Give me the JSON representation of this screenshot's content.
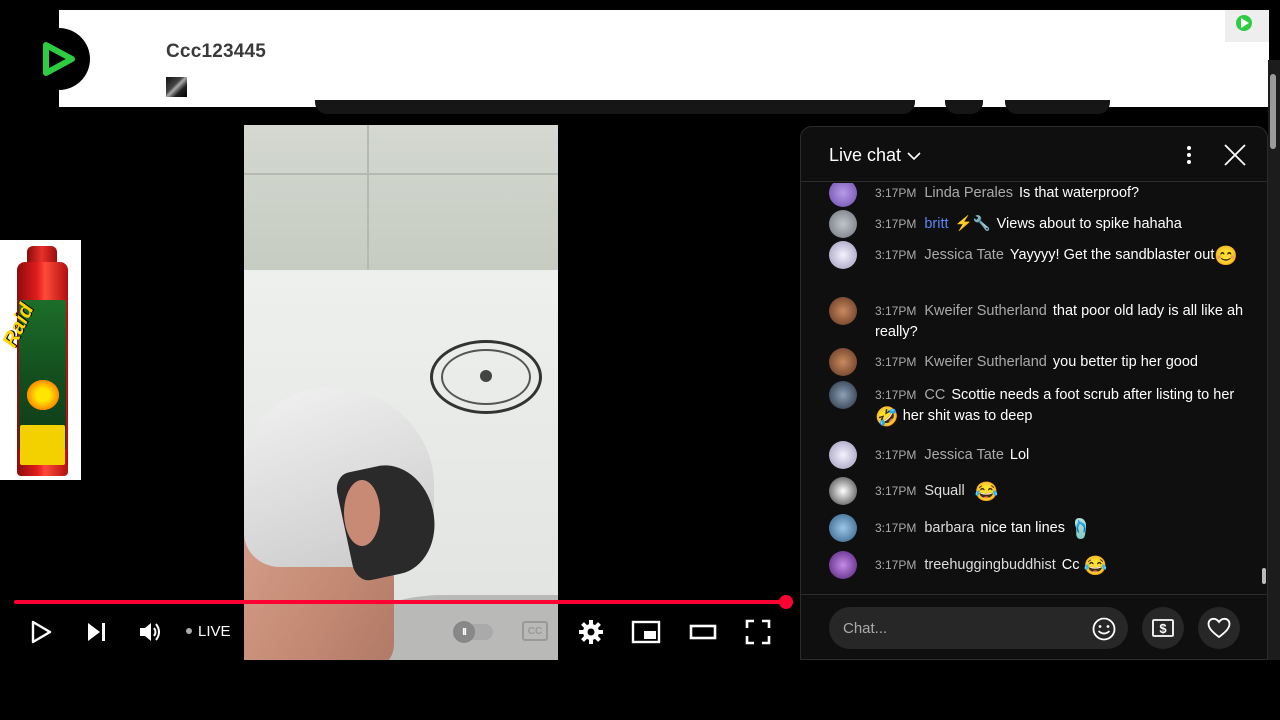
{
  "banner": {
    "title": "Ccc123445",
    "accent": "#2ecc40"
  },
  "player": {
    "live_label": "LIVE",
    "cc_label": "CC",
    "autoplay_label": "II",
    "progress_fraction": 1.0,
    "progress_color": "#ff0033"
  },
  "ad": {
    "can_brand": "Raid"
  },
  "chat": {
    "title": "Live chat",
    "input_placeholder": "Chat...",
    "messages": [
      {
        "time": "3:17PM",
        "author": "Linda Perales",
        "text": "Is that waterproof?",
        "avatar_color": "#6a4bb0"
      },
      {
        "time": "3:17PM",
        "author": "britt",
        "author_badges": "⚡🔧",
        "text": "Views about to spike hahaha",
        "avatar_color": "#8a8f94"
      },
      {
        "time": "3:17PM",
        "author": "Jessica Tate",
        "text": "Yayyyy! Get the sandblaster out",
        "emoji": "😊",
        "avatar_color": "#c9c6d6"
      },
      {
        "time": "3:17PM",
        "author": "Kweifer Sutherland",
        "text": "that poor old lady is all like ah really?",
        "avatar_color": "#7a4a2e"
      },
      {
        "time": "3:17PM",
        "author": "Kweifer Sutherland",
        "text": "you better tip her good",
        "avatar_color": "#7a4a2e"
      },
      {
        "time": "3:17PM",
        "author": "CC",
        "text_before": "Scottie needs a foot scrub after listing to her",
        "emoji": "🤣",
        "text_after": "her shit was to deep",
        "avatar_color": "#3b4a5c"
      },
      {
        "time": "3:17PM",
        "author": "Jessica Tate",
        "text": "Lol",
        "avatar_color": "#c9c6d6"
      },
      {
        "time": "3:17PM",
        "author": "Squall",
        "emoji": "😂",
        "avatar_color": "#dcdcdc"
      },
      {
        "time": "3:17PM",
        "author": "barbara",
        "text": "nice tan lines",
        "emoji": "🩴",
        "avatar_color": "#4a7fa8"
      },
      {
        "time": "3:17PM",
        "author": "treehuggingbuddhist",
        "text": "Cc",
        "emoji": "😂",
        "avatar_color": "#7b3fa8"
      }
    ]
  }
}
